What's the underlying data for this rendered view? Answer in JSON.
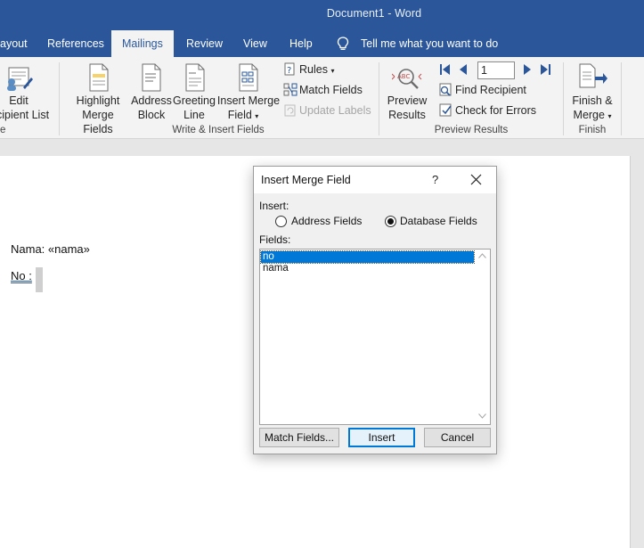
{
  "window": {
    "title": "Document1  -  Word"
  },
  "tabs": [
    {
      "label": "ayout",
      "active": false
    },
    {
      "label": "References",
      "active": false
    },
    {
      "label": "Mailings",
      "active": true
    },
    {
      "label": "Review",
      "active": false
    },
    {
      "label": "View",
      "active": false
    },
    {
      "label": "Help",
      "active": false
    }
  ],
  "tell_me": {
    "text": "Tell me what you want to do",
    "icon": "lightbulb-icon"
  },
  "ribbon": {
    "edit_list": {
      "line1": "Edit",
      "line2": "cipient List"
    },
    "highlight": {
      "line1": "Highlight",
      "line2": "Merge Fields"
    },
    "address_block": {
      "line1": "Address",
      "line2": "Block"
    },
    "greeting_line": {
      "line1": "Greeting",
      "line2": "Line"
    },
    "insert_merge_field": {
      "line1": "Insert Merge",
      "line2": "Field"
    },
    "rules": "Rules",
    "match_fields": "Match Fields",
    "update_labels": "Update Labels",
    "group_write_insert": "Write & Insert Fields",
    "preview_results": {
      "line1": "Preview",
      "line2": "Results"
    },
    "record_number": "1",
    "find_recipient": "Find Recipient",
    "check_errors": "Check for Errors",
    "group_preview": "Preview Results",
    "finish_merge": {
      "line1": "Finish &",
      "line2": "Merge"
    },
    "group_finish": "Finish",
    "left_group_fragment": "e"
  },
  "document": {
    "line1": "Nama: «nama»",
    "line2_label": "No :"
  },
  "dialog": {
    "title": "Insert Merge Field",
    "help": "?",
    "insert_label": "Insert:",
    "radio_address": {
      "label": "Address Fields",
      "checked": false
    },
    "radio_database": {
      "label": "Database Fields",
      "checked": true
    },
    "fields_label": "Fields:",
    "fields": [
      {
        "name": "no",
        "selected": true
      },
      {
        "name": "nama",
        "selected": false
      }
    ],
    "buttons": {
      "match_fields": "Match Fields...",
      "insert": "Insert",
      "cancel": "Cancel"
    }
  },
  "colors": {
    "word_blue": "#2b579a",
    "selection_blue": "#0078d7",
    "ribbon_bg": "#f3f3f3"
  }
}
